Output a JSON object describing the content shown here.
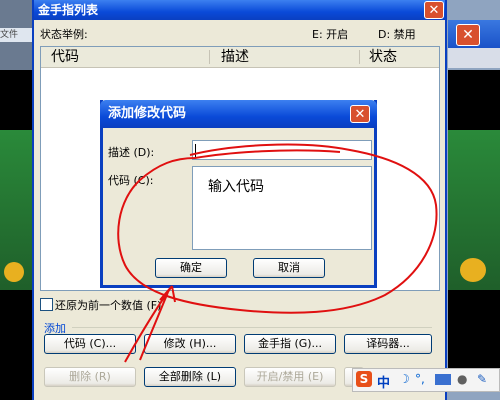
{
  "main_window": {
    "title": "金手指列表",
    "close_glyph": "✕",
    "status_example_label": "状态举例:",
    "status_enable": "E: 开启",
    "status_disable": "D: 禁用",
    "columns": [
      "代码",
      "描述",
      "状态"
    ],
    "restore_checkbox_label": "还原为前一个数值 (F)",
    "add_group_label": "添加",
    "buttons_row1": [
      "代码 (C)...",
      "修改 (H)...",
      "金手指 (G)...",
      "译码器..."
    ],
    "buttons_row2": [
      "删除 (R)",
      "全部删除 (L)",
      "开启/禁用 (E)"
    ]
  },
  "background_window": {
    "menu_fragment": "文件"
  },
  "dialog": {
    "title": "添加修改代码",
    "close_glyph": "✕",
    "description_label": "描述 (D):",
    "code_label": "代码 (C):",
    "description_value": "",
    "code_value": "",
    "ok_label": "确定",
    "cancel_label": "取消"
  },
  "annotation": {
    "handwritten_text": "输入代码",
    "stroke_color": "#e01010"
  },
  "ime": {
    "logo": "S",
    "mode": "中",
    "icons": [
      "moon-icon",
      "punctuation-icon",
      "keyboard-icon",
      "user-icon",
      "wrench-icon"
    ]
  }
}
